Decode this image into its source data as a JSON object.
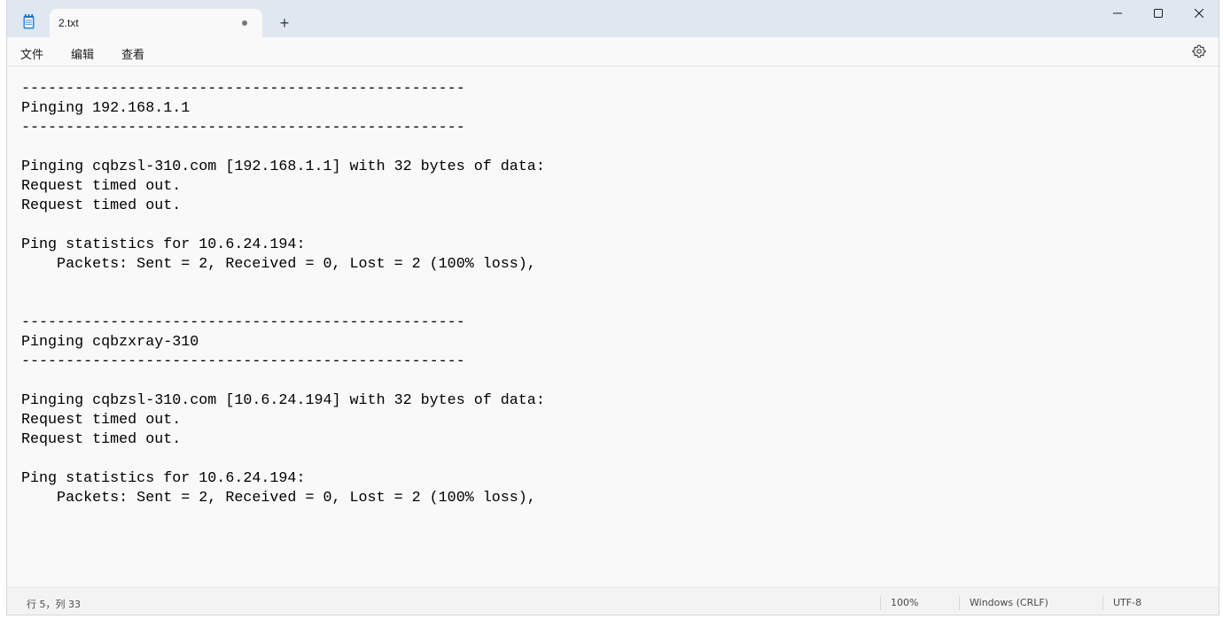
{
  "tab": {
    "title": "2.txt",
    "new_tab": "+"
  },
  "menu": {
    "file": "文件",
    "edit": "编辑",
    "view": "查看"
  },
  "editor": {
    "lines": [
      "--------------------------------------------------",
      "Pinging 192.168.1.1",
      "--------------------------------------------------",
      "",
      "Pinging cqbzsl-310.com [192.168.1.1] with 32 bytes of data:",
      "Request timed out.",
      "Request timed out.",
      "",
      "Ping statistics for 10.6.24.194:",
      "    Packets: Sent = 2, Received = 0, Lost = 2 (100% loss),",
      "",
      "",
      "--------------------------------------------------",
      "Pinging cqbzxray-310",
      "--------------------------------------------------",
      "",
      "Pinging cqbzsl-310.com [10.6.24.194] with 32 bytes of data:",
      "Request timed out.",
      "Request timed out.",
      "",
      "Ping statistics for 10.6.24.194:",
      "    Packets: Sent = 2, Received = 0, Lost = 2 (100% loss),"
    ]
  },
  "status": {
    "cursor": "行 5，列 33",
    "zoom": "100%",
    "line_ending": "Windows (CRLF)",
    "encoding": "UTF-8"
  },
  "icons": {
    "app": "notepad-icon",
    "minimize": "minimize-icon",
    "maximize": "maximize-icon",
    "close": "close-icon",
    "settings": "gear-icon"
  },
  "colors": {
    "titlebar": "#dfe8f1",
    "app_icon": "#1e73c8"
  }
}
